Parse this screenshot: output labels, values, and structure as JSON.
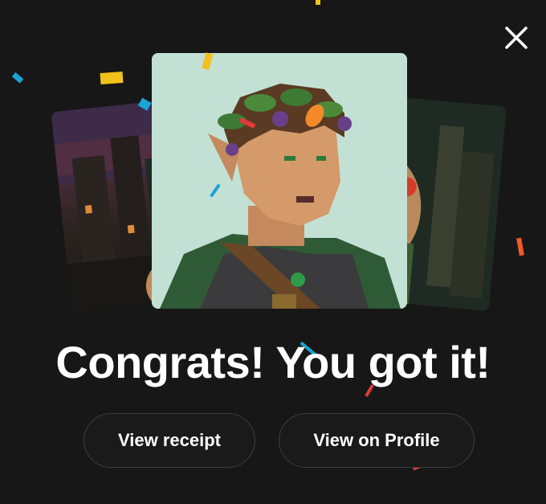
{
  "dialog": {
    "close_icon": "close-icon",
    "headline": "Congrats! You got it!",
    "buttons": {
      "receipt_label": "View receipt",
      "profile_label": "View on Profile"
    }
  },
  "colors": {
    "background": "#171717",
    "text": "#ffffff",
    "button_border": "#3d3d3d",
    "card_background": "#c2e1d4"
  }
}
